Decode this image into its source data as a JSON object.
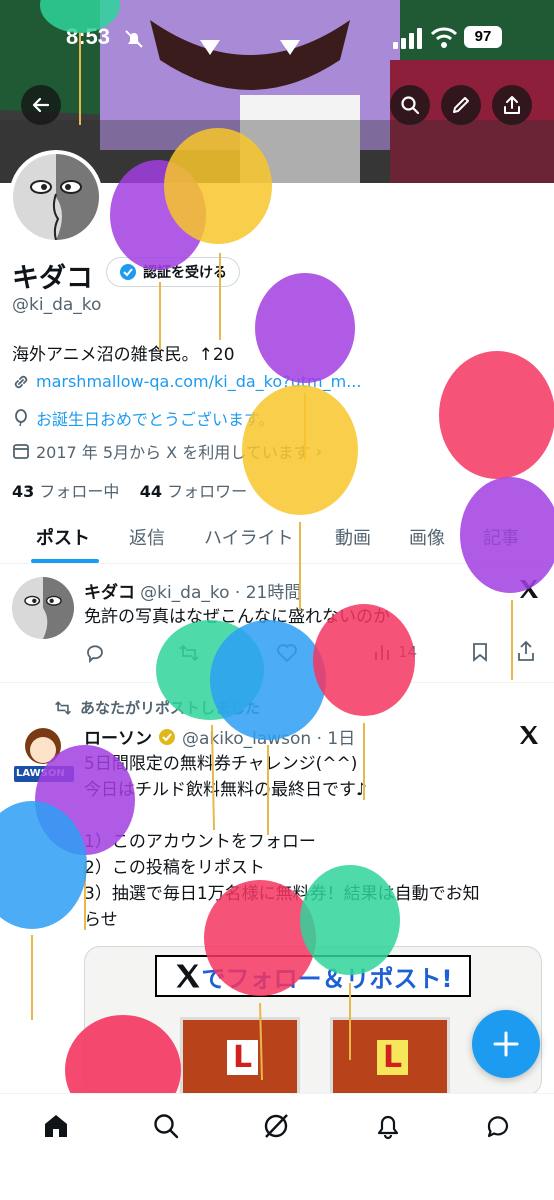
{
  "status_bar": {
    "time": "8:53",
    "battery": "97"
  },
  "profile": {
    "name": "キダコ",
    "verify_label": "認証を受ける",
    "handle": "@ki_da_ko",
    "bio": "海外アニメ沼の雑食民。↑20",
    "link": "marshmallow-qa.com/ki_da_ko?utm_m...",
    "birthday": "お誕生日おめでとうございます。",
    "joined": "2017 年 5月から X を利用しています",
    "following_count": "43",
    "following_label": "フォロー中",
    "followers_count": "44",
    "followers_label": "フォロワー"
  },
  "tabs": [
    "ポスト",
    "返信",
    "ハイライト",
    "動画",
    "画像",
    "記事"
  ],
  "post1": {
    "name": "キダコ",
    "meta": "@ki_da_ko · 21時間",
    "text": "免許の写真はなぜこんなに盛れないのか",
    "views": "14"
  },
  "post2": {
    "repost_label": "あなたがリポストしました",
    "name": "ローソン",
    "meta": "@akiko_lawson · 1日",
    "lines": [
      "5日間限定の無料券チャレンジ(^^)",
      "今日はチルド飲料無料の最終日です♪",
      "",
      "1）このアカウントをフォロー",
      "2）この投稿をリポスト",
      "3）抽選で毎日1万名様に無料券！結果は自動でお知",
      "らせ"
    ],
    "card_text": "でフォロー＆リポスト!",
    "card_letter": "L",
    "badge": "LAWSON"
  },
  "colors": {
    "accent": "#1d9bf0",
    "text": "#0f1419",
    "muted": "#536471"
  }
}
